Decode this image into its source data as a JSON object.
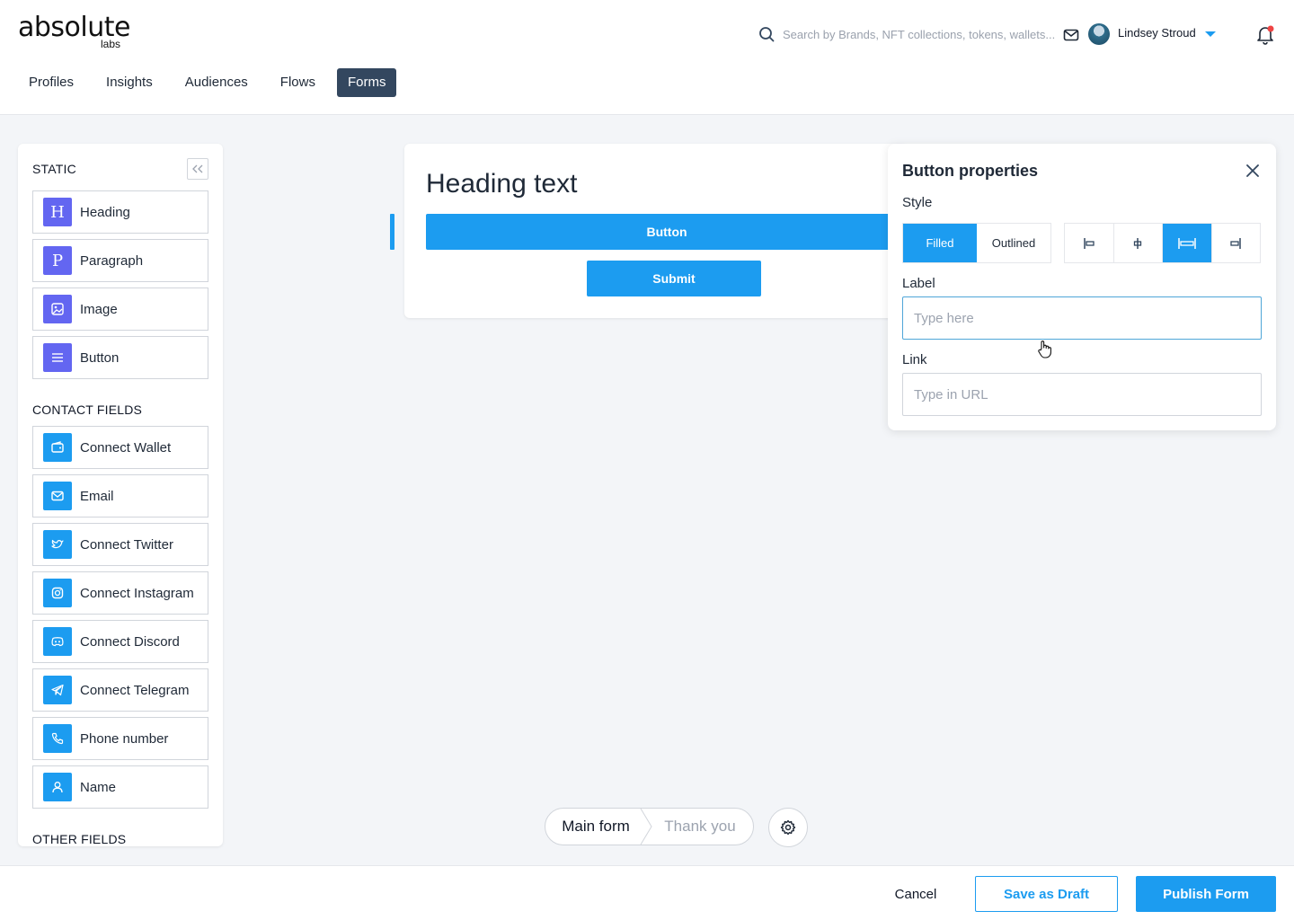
{
  "brand": {
    "name": "absolute",
    "sub": "labs"
  },
  "header": {
    "search_placeholder": "Search by Brands, NFT collections, tokens, wallets...",
    "user_name": "Lindsey Stroud"
  },
  "nav": {
    "tabs": [
      {
        "label": "Profiles",
        "active": false
      },
      {
        "label": "Insights",
        "active": false
      },
      {
        "label": "Audiences",
        "active": false
      },
      {
        "label": "Flows",
        "active": false
      },
      {
        "label": "Forms",
        "active": true
      }
    ]
  },
  "sidebar": {
    "static_title": "STATIC",
    "static_items": [
      {
        "label": "Heading",
        "icon": "heading-icon"
      },
      {
        "label": "Paragraph",
        "icon": "paragraph-icon"
      },
      {
        "label": "Image",
        "icon": "image-icon"
      },
      {
        "label": "Button",
        "icon": "button-icon"
      }
    ],
    "contact_title": "CONTACT FIELDS",
    "contact_items": [
      {
        "label": "Connect Wallet",
        "icon": "wallet-icon"
      },
      {
        "label": "Email",
        "icon": "email-icon"
      },
      {
        "label": "Connect Twitter",
        "icon": "twitter-icon"
      },
      {
        "label": "Connect Instagram",
        "icon": "instagram-icon"
      },
      {
        "label": "Connect Discord",
        "icon": "discord-icon"
      },
      {
        "label": "Connect Telegram",
        "icon": "telegram-icon"
      },
      {
        "label": "Phone number",
        "icon": "phone-icon"
      },
      {
        "label": "Name",
        "icon": "user-icon"
      }
    ],
    "other_title": "OTHER FIELDS"
  },
  "canvas": {
    "heading": "Heading text",
    "button_label": "Button",
    "submit_label": "Submit"
  },
  "props": {
    "title": "Button properties",
    "style_label": "Style",
    "style_options": [
      "Filled",
      "Outlined"
    ],
    "style_selected": "Filled",
    "alignment_selected": "full-width",
    "label_label": "Label",
    "label_placeholder": "Type here",
    "label_value": "",
    "link_label": "Link",
    "link_placeholder": "Type in URL",
    "link_value": ""
  },
  "pages": {
    "main": "Main form",
    "thanks": "Thank you"
  },
  "footer": {
    "cancel": "Cancel",
    "draft": "Save as Draft",
    "publish": "Publish Form"
  },
  "colors": {
    "accent": "#1c9cf0",
    "nav_active": "#33475f",
    "static_icon": "#6366f1"
  }
}
